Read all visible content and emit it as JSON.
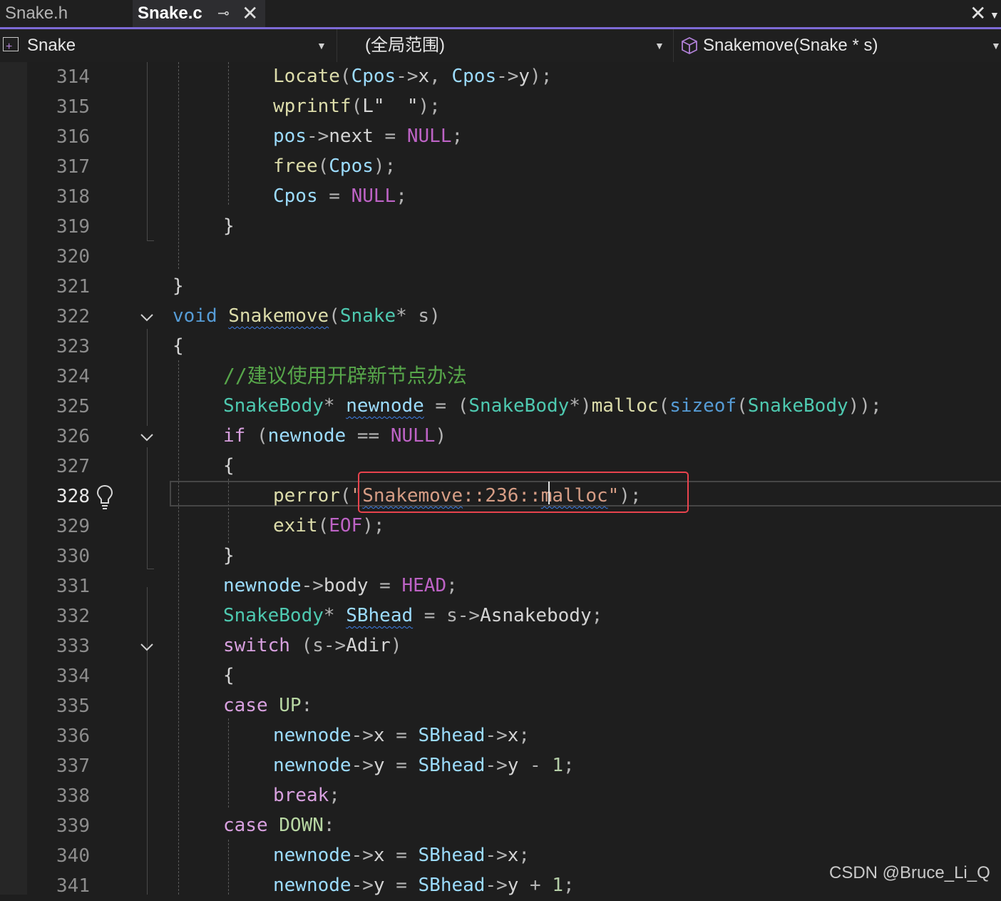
{
  "tabs": [
    {
      "label": "Snake.h",
      "active": false
    },
    {
      "label": "Snake.c",
      "active": true
    }
  ],
  "navbar": {
    "project": "Snake",
    "scope": "(全局范围)",
    "member": "Snakemove(Snake * s)"
  },
  "editor": {
    "current_line": 328,
    "lines": [
      {
        "n": "314",
        "t": "Locate(Cpos->x, Cpos->y);"
      },
      {
        "n": "315",
        "t": "wprintf(L\"  \");"
      },
      {
        "n": "316",
        "t": "pos->next = NULL;"
      },
      {
        "n": "317",
        "t": "free(Cpos);"
      },
      {
        "n": "318",
        "t": "Cpos = NULL;"
      },
      {
        "n": "319",
        "t": "}"
      },
      {
        "n": "320",
        "t": ""
      },
      {
        "n": "321",
        "t": "}"
      },
      {
        "n": "322",
        "t": "void Snakemove(Snake* s)"
      },
      {
        "n": "323",
        "t": "{"
      },
      {
        "n": "324",
        "t": "//建议使用开辟新节点办法"
      },
      {
        "n": "325",
        "t": "SnakeBody* newnode = (SnakeBody*)malloc(sizeof(SnakeBody));"
      },
      {
        "n": "326",
        "t": "if (newnode == NULL)"
      },
      {
        "n": "327",
        "t": "{"
      },
      {
        "n": "328",
        "t": "perror(\"Snakemove::236::malloc\");"
      },
      {
        "n": "329",
        "t": "exit(EOF);"
      },
      {
        "n": "330",
        "t": "}"
      },
      {
        "n": "331",
        "t": "newnode->body = HEAD;"
      },
      {
        "n": "332",
        "t": "SnakeBody* SBhead = s->Asnakebody;"
      },
      {
        "n": "333",
        "t": "switch (s->Adir)"
      },
      {
        "n": "334",
        "t": "{"
      },
      {
        "n": "335",
        "t": "case UP:"
      },
      {
        "n": "336",
        "t": "newnode->x = SBhead->x;"
      },
      {
        "n": "337",
        "t": "newnode->y = SBhead->y - 1;"
      },
      {
        "n": "338",
        "t": "break;"
      },
      {
        "n": "339",
        "t": "case DOWN:"
      },
      {
        "n": "340",
        "t": "newnode->x = SBhead->x;"
      },
      {
        "n": "341",
        "t": "newnode->y = SBhead->y + 1;"
      }
    ]
  },
  "watermark": "CSDN @Bruce_Li_Q",
  "icons": [
    "pin-icon",
    "close-icon",
    "project-icon",
    "cube-icon",
    "chevron-down-icon",
    "lightbulb-icon"
  ],
  "colors": {
    "accent": "#7d6ad6",
    "highlight_box": "#e8434d"
  }
}
